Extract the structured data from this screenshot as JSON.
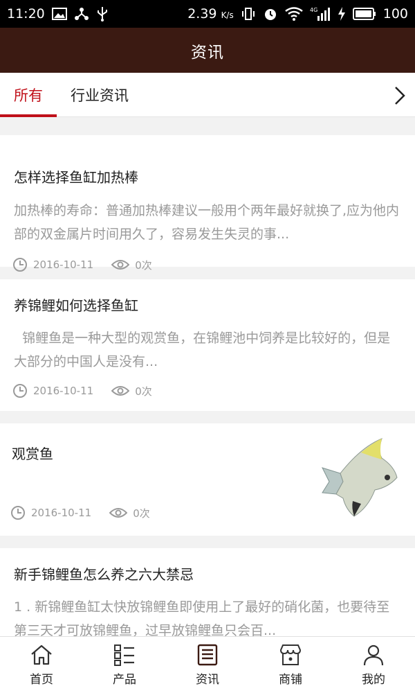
{
  "status": {
    "time": "11:20",
    "speed": "2.39",
    "speed_unit": "K/s",
    "battery": "100",
    "network": "4G"
  },
  "header": {
    "title": "资讯"
  },
  "tabs": [
    {
      "label": "所有"
    },
    {
      "label": "行业资讯"
    }
  ],
  "articles": [
    {
      "title": "怎样选择鱼缸加热棒",
      "summary": "加热棒的寿命：普通加热棒建议一般用个两年最好就换了,应为他内部的双金属片时间用久了，容易发生失灵的事...",
      "date": "2016-10-11",
      "views": "0次"
    },
    {
      "title": "养锦鲤如何选择鱼缸",
      "summary": "  锦鲤鱼是一种大型的观赏鱼，在锦鲤池中饲养是比较好的，但是大部分的中国人是没有...",
      "date": "2016-10-11",
      "views": "0次"
    },
    {
      "title": "观赏鱼",
      "summary": "",
      "date": "2016-10-11",
      "views": "0次"
    },
    {
      "title": "新手锦鲤鱼怎么养之六大禁忌",
      "summary": "1 . 新锦鲤鱼缸太快放锦鲤鱼即使用上了最好的硝化菌，也要待至第三天才可放锦鲤鱼，过早放锦鲤鱼只会百...",
      "date": "",
      "views": ""
    }
  ],
  "nav": [
    {
      "label": "首页"
    },
    {
      "label": "产品"
    },
    {
      "label": "资讯"
    },
    {
      "label": "商铺"
    },
    {
      "label": "我的"
    }
  ]
}
